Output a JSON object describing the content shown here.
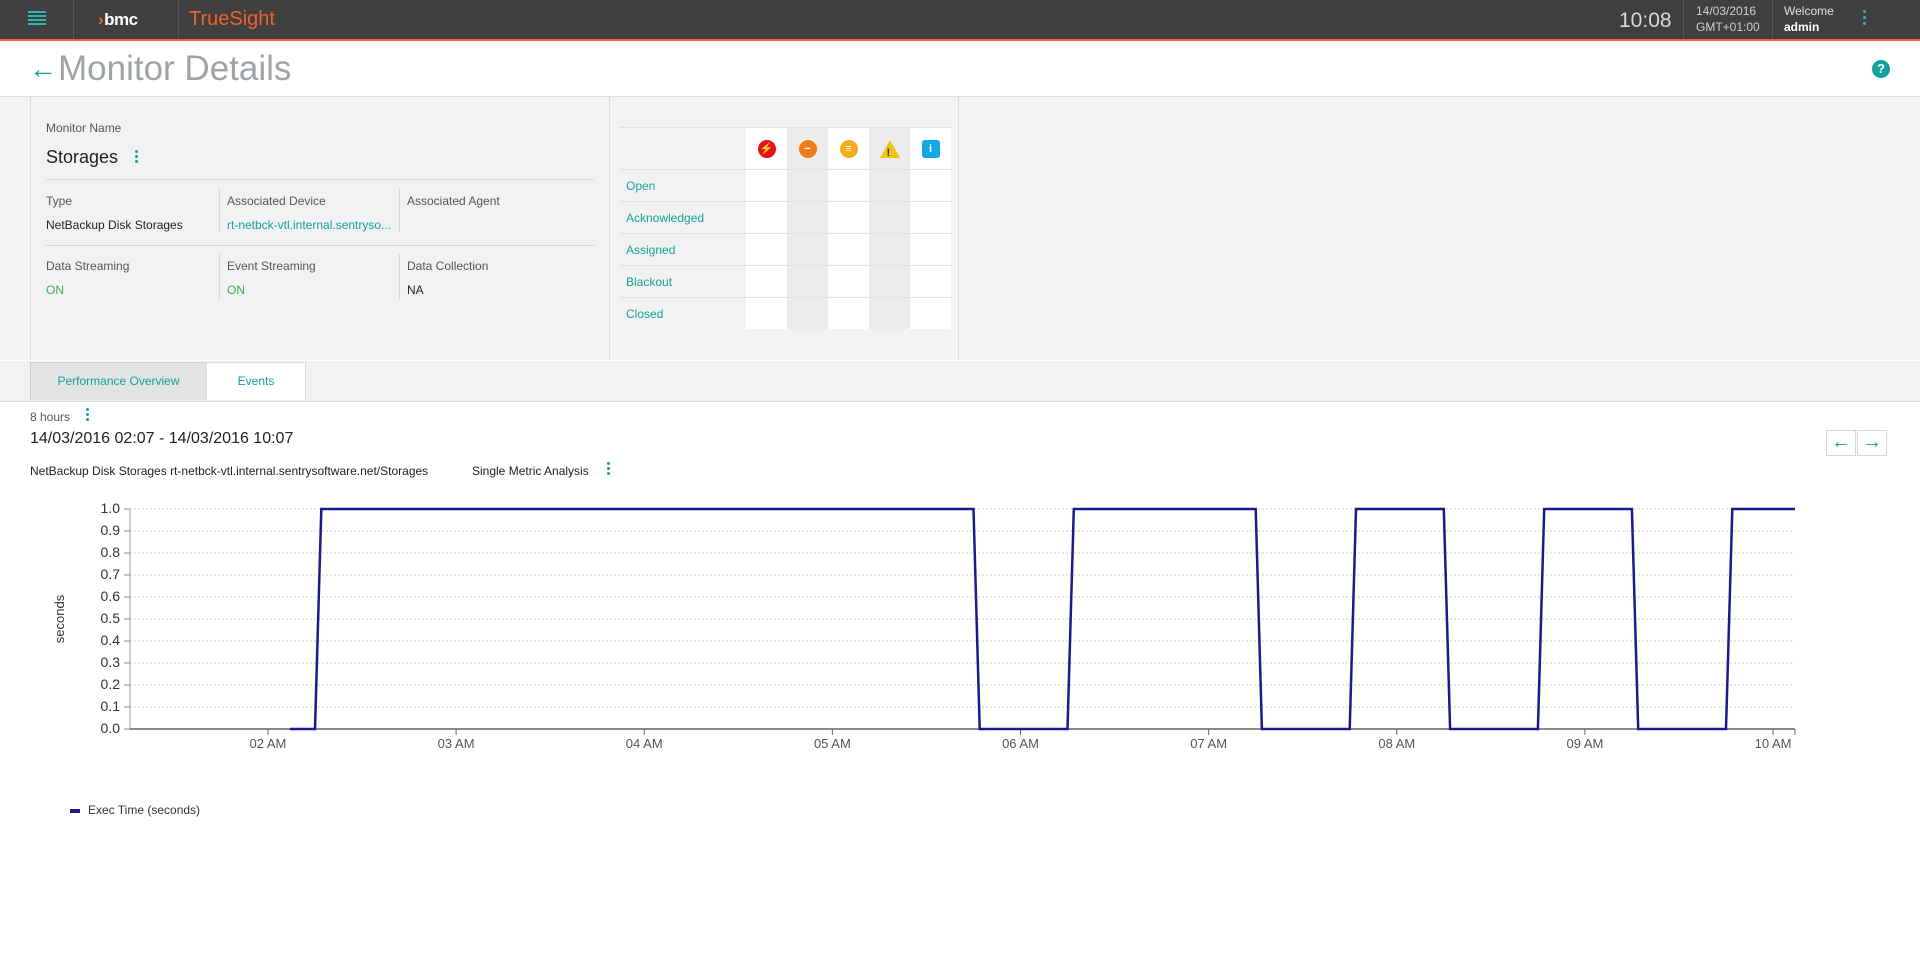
{
  "topbar": {
    "brand": "bmc",
    "product": "TrueSight",
    "time": "10:08",
    "date": "14/03/2016",
    "timezone": "GMT+01:00",
    "welcome": "Welcome",
    "user": "admin"
  },
  "header": {
    "title": "Monitor Details"
  },
  "monitor": {
    "name_label": "Monitor Name",
    "name": "Storages",
    "fields": {
      "type_label": "Type",
      "type": "NetBackup Disk Storages",
      "device_label": "Associated Device",
      "device": "rt-netbck-vtl.internal.sentryso...",
      "agent_label": "Associated Agent",
      "agent": "",
      "data_streaming_label": "Data Streaming",
      "data_streaming": "ON",
      "event_streaming_label": "Event Streaming",
      "event_streaming": "ON",
      "data_collection_label": "Data Collection",
      "data_collection": "NA"
    }
  },
  "events": {
    "severities": [
      "critical-icon",
      "major-icon",
      "minor-icon",
      "warning-icon",
      "info-icon"
    ],
    "rows": [
      "Open",
      "Acknowledged",
      "Assigned",
      "Blackout",
      "Closed"
    ]
  },
  "tabs": [
    "Performance Overview",
    "Events"
  ],
  "performance": {
    "range": "8 hours",
    "time_range": "14/03/2016 02:07 - 14/03/2016 10:07",
    "metric_description": "NetBackup Disk Storages rt-netbck-vtl.internal.sentrysoftware.net/Storages",
    "mode": "Single Metric Analysis"
  },
  "colors": {
    "accent": "#14a19b",
    "brand_orange": "#f0622d",
    "series": "#1a1a8c"
  },
  "chart_data": {
    "type": "line",
    "title": "",
    "xlabel": "",
    "ylabel": "seconds",
    "ylim": [
      0,
      1.0
    ],
    "yticks": [
      "0.0",
      "0.1",
      "0.2",
      "0.3",
      "0.4",
      "0.5",
      "0.6",
      "0.7",
      "0.8",
      "0.9",
      "1.0"
    ],
    "xlim": [
      "01:16",
      "10:07"
    ],
    "xticks": [
      {
        "t": "02:00",
        "label": "02 AM"
      },
      {
        "t": "03:00",
        "label": "03 AM"
      },
      {
        "t": "04:00",
        "label": "04 AM"
      },
      {
        "t": "05:00",
        "label": "05 AM"
      },
      {
        "t": "06:00",
        "label": "06 AM"
      },
      {
        "t": "07:00",
        "label": "07 AM"
      },
      {
        "t": "08:00",
        "label": "08 AM"
      },
      {
        "t": "09:00",
        "label": "09 AM"
      },
      {
        "t": "10:00",
        "label": "10 AM"
      }
    ],
    "grid": "horizontal",
    "series": [
      {
        "name": "Exec Time (seconds)",
        "x": [
          "02:07",
          "02:15",
          "02:17",
          "05:45",
          "05:47",
          "06:15",
          "06:17",
          "07:15",
          "07:17",
          "07:45",
          "07:47",
          "08:15",
          "08:17",
          "08:45",
          "08:47",
          "09:15",
          "09:17",
          "09:45",
          "09:47",
          "10:07"
        ],
        "y": [
          0,
          0,
          1,
          1,
          0,
          0,
          1,
          1,
          0,
          0,
          1,
          1,
          0,
          0,
          1,
          1,
          0,
          0,
          1,
          1
        ]
      }
    ]
  }
}
